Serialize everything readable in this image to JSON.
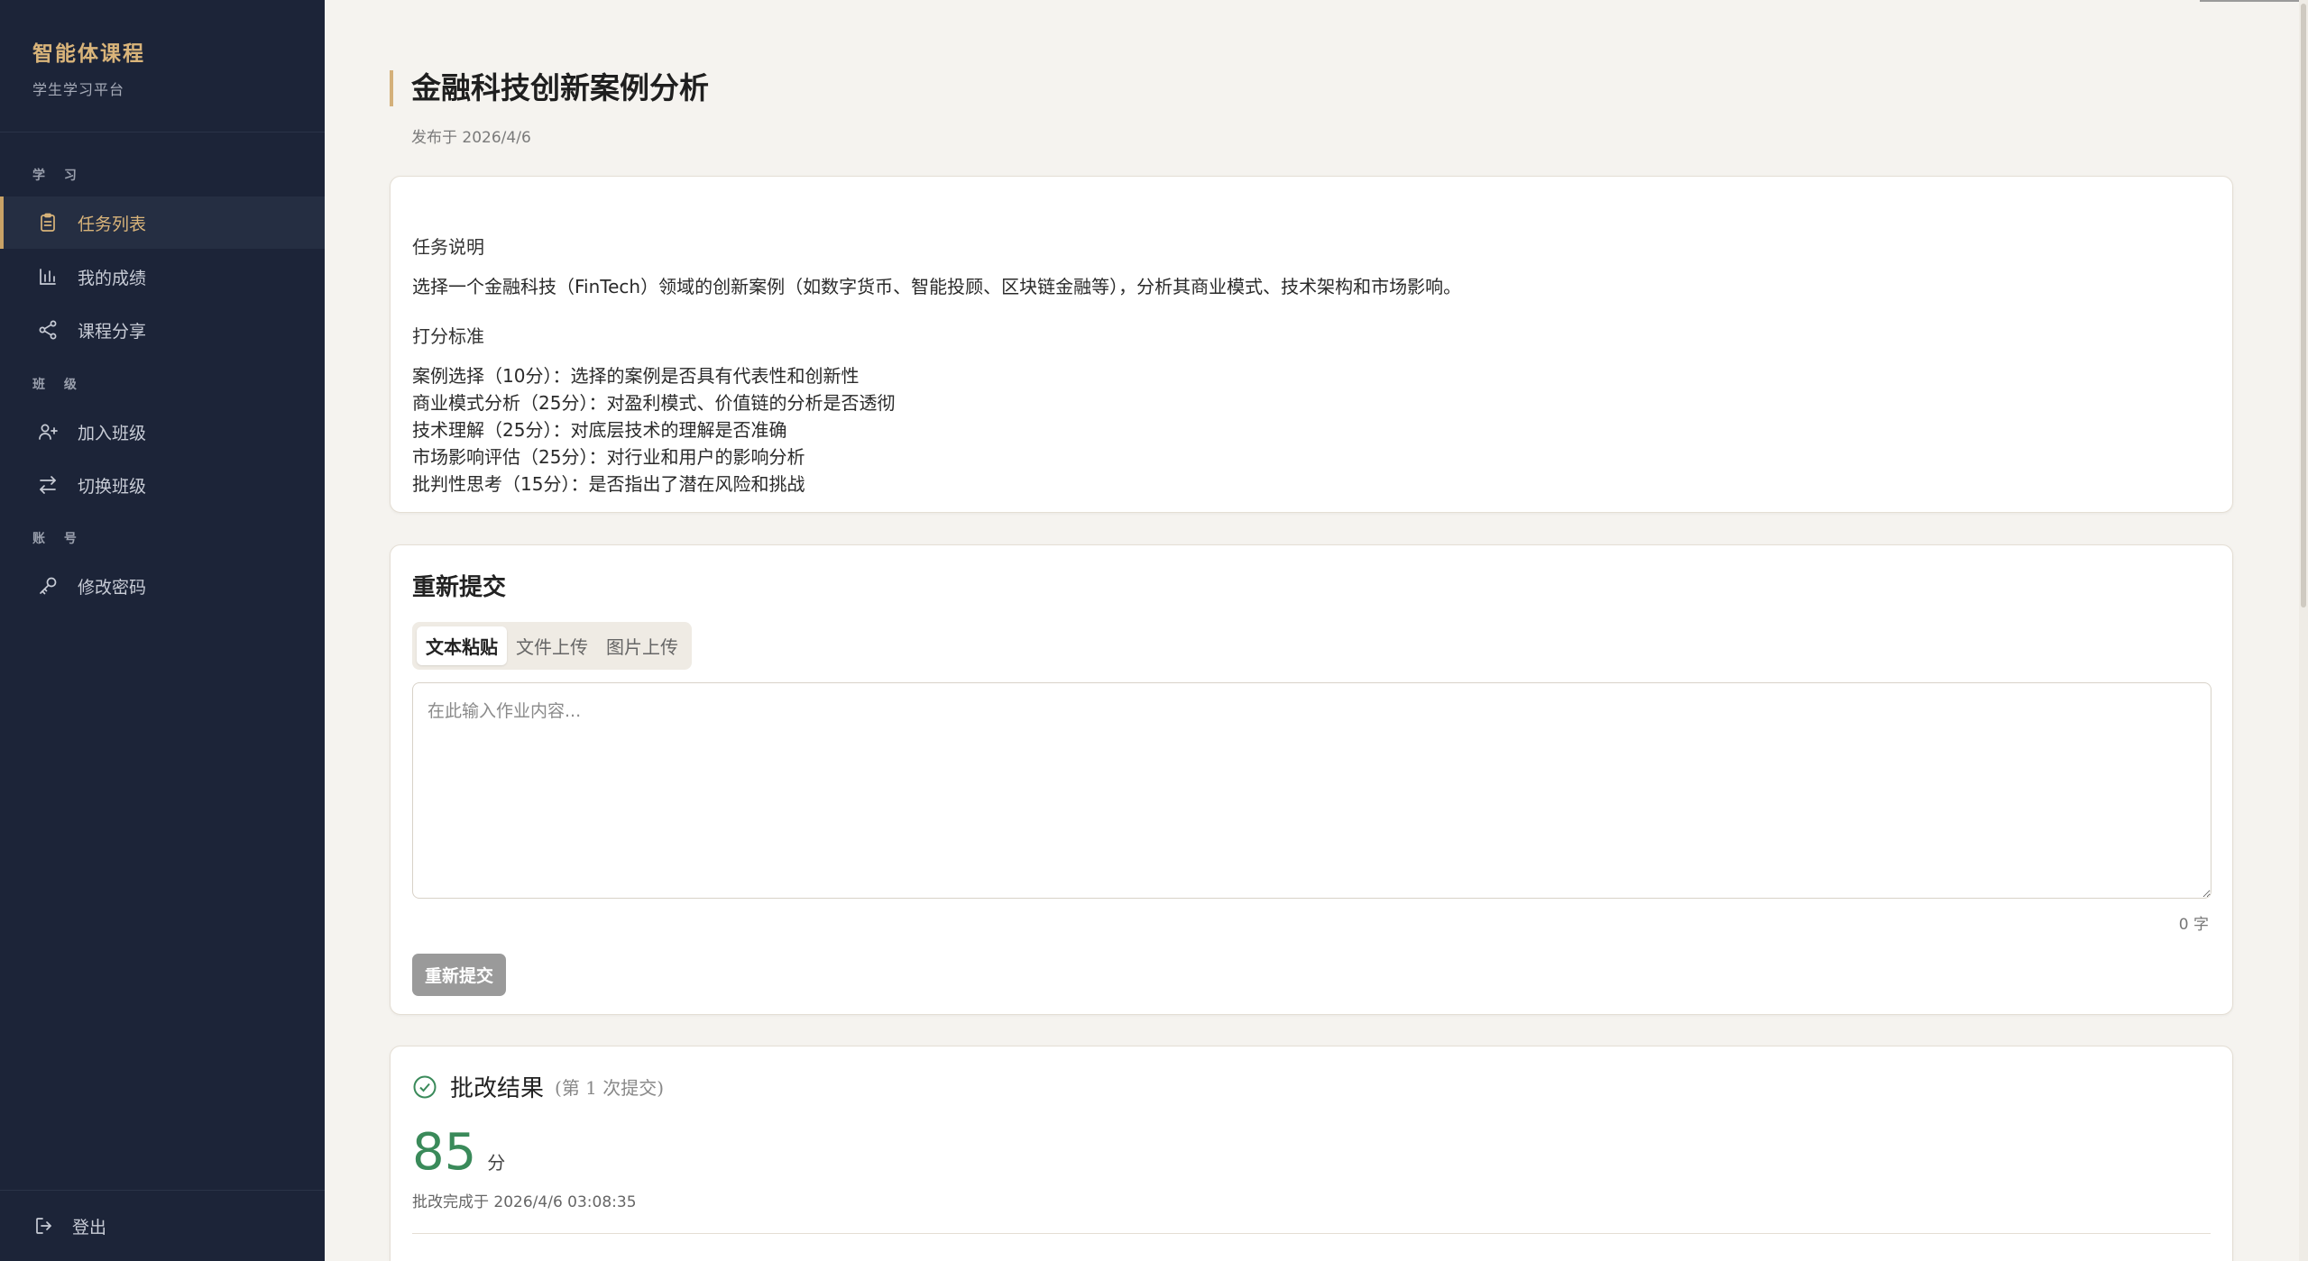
{
  "sidebar": {
    "brand_title": "智能体课程",
    "brand_sub": "学生学习平台",
    "sections": {
      "learn": "学 习",
      "class": "班 级",
      "account": "账 号"
    },
    "items": {
      "tasks": "任务列表",
      "grades": "我的成绩",
      "share": "课程分享",
      "join": "加入班级",
      "switch": "切换班级",
      "password": "修改密码"
    },
    "logout": "登出"
  },
  "page": {
    "title": "金融科技创新案例分析",
    "meta": "发布于 2026/4/6"
  },
  "task": {
    "desc_heading": "任务说明",
    "desc_text": "选择一个金融科技（FinTech）领域的创新案例（如数字货币、智能投顾、区块链金融等），分析其商业模式、技术架构和市场影响。",
    "criteria_heading": "打分标准",
    "criteria": [
      "案例选择（10分）：选择的案例是否具有代表性和创新性",
      "商业模式分析（25分）：对盈利模式、价值链的分析是否透彻",
      "技术理解（25分）：对底层技术的理解是否准确",
      "市场影响评估（25分）：对行业和用户的影响分析",
      "批判性思考（15分）：是否指出了潜在风险和挑战"
    ]
  },
  "submit": {
    "title": "重新提交",
    "tabs": [
      "文本粘贴",
      "文件上传",
      "图片上传"
    ],
    "placeholder": "在此输入作业内容...",
    "count": "0 字",
    "button": "重新提交"
  },
  "result": {
    "title": "批改结果",
    "sub": "(第 1 次提交)",
    "score": "85",
    "unit": "分",
    "time": "批改完成于 2026/4/6 03:08:35"
  },
  "colors": {
    "sidebar_bg": "#1c2438",
    "accent": "#d9b47a",
    "score_green": "#3a8a5a"
  }
}
